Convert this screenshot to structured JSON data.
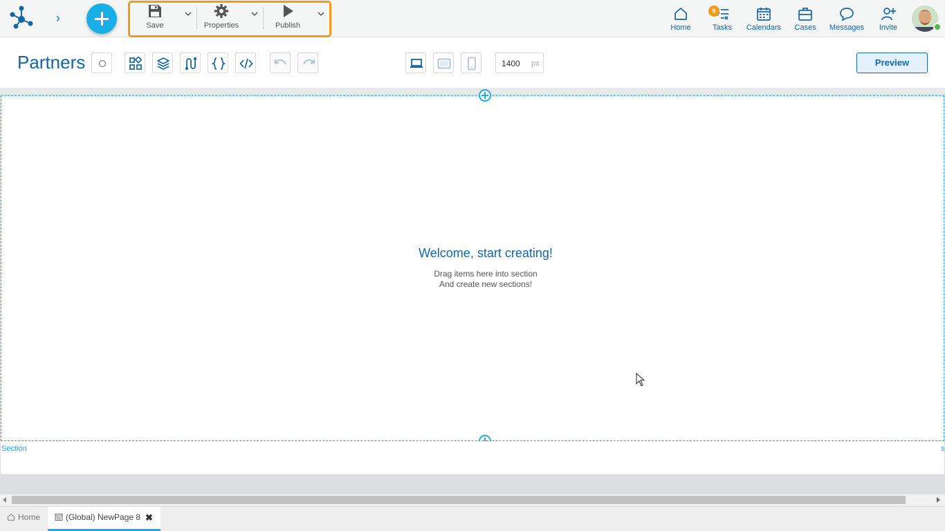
{
  "header": {
    "expand_glyph": "›",
    "actions": {
      "save_label": "Save",
      "properties_label": "Properties",
      "publish_label": "Publish"
    },
    "nav": {
      "home": "Home",
      "tasks": "Tasks",
      "tasks_badge": "9",
      "calendars": "Calendars",
      "cases": "Cases",
      "messages": "Messages",
      "invite": "Invite"
    },
    "highlight_color": "#f39a1a",
    "accent_color": "#18aee6",
    "brand_color": "#1466a6"
  },
  "pagebar": {
    "title": "Partners",
    "width_value": "1400",
    "width_unit": "px",
    "preview_label": "Preview",
    "tools": [
      "status-indicator-icon",
      "components-icon",
      "layers-icon",
      "flow-icon",
      "braces-icon",
      "code-icon",
      "undo-icon",
      "redo-icon",
      "desktop-icon",
      "tablet-icon",
      "mobile-icon"
    ]
  },
  "canvas": {
    "welcome_title": "Welcome, start creating!",
    "hint_line1": "Drag items here into section",
    "hint_line2": "And create new sections!",
    "section_label": "Section",
    "section_label_right": "s"
  },
  "tabs": {
    "home_label": "Home",
    "page_label": "(Global) NewPage 8",
    "close_glyph": "✖"
  }
}
